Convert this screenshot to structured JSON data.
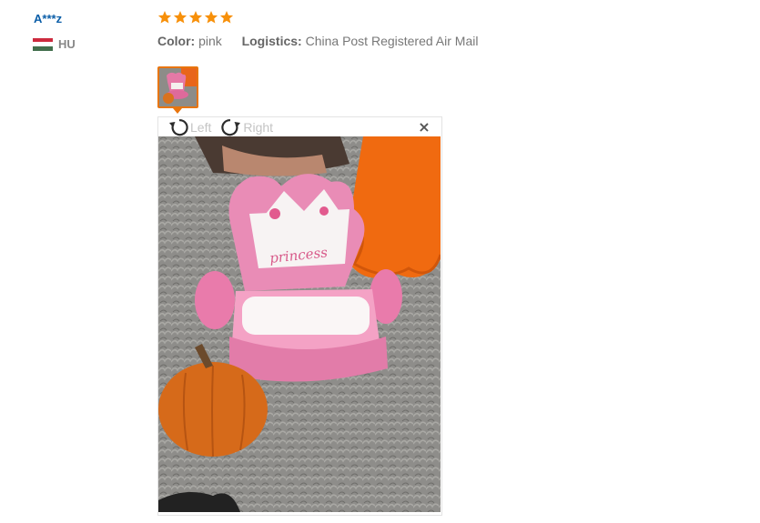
{
  "review": {
    "user_name": "A***z",
    "country_code": "HU",
    "flag_colors": [
      "#cd2a3e",
      "#ffffff",
      "#436f4d"
    ],
    "rating": 5,
    "star_color": "#f7900a",
    "color_label": "Color:",
    "color_value": "pink",
    "logistics_label": "Logistics:",
    "logistics_value": "China Post Registered Air Mail"
  },
  "viewer": {
    "rotate_left_label": "Left",
    "rotate_right_label": "Right",
    "close_glyph": "×",
    "photo_text": "princess",
    "accent_color": "#e8750d"
  }
}
